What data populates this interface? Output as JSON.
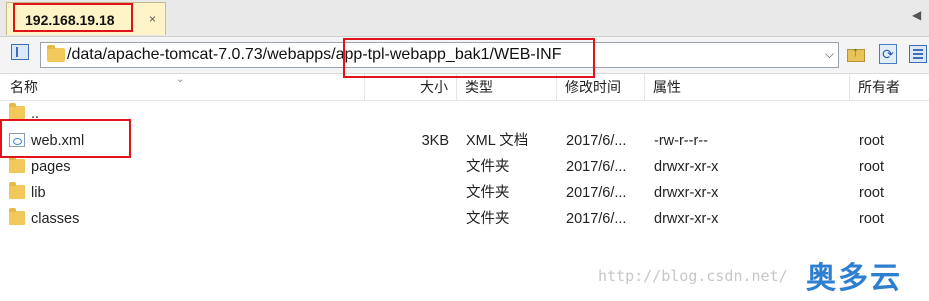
{
  "tab": {
    "title": "192.168.19.18",
    "close_glyph": "×"
  },
  "nav": {
    "scroll_glyph": "◀"
  },
  "address": {
    "path_part1": "/data/apache-tomcat-7.0.73/webapps/",
    "path_part2": "app-tpl-webapp_bak1/WEB-INF",
    "dropdown_glyph": "⌵"
  },
  "toolbar": {
    "up_icon": "parent-folder-icon",
    "refresh_icon": "refresh-icon",
    "view_icon": "view-mode-icon",
    "refresh_glyph": "⟳",
    "up_glyph": "↑"
  },
  "columns": {
    "name": "名称",
    "size": "大小",
    "type": "类型",
    "modified": "修改时间",
    "attributes": "属性",
    "owner": "所有者",
    "sort_glyph": "⌄"
  },
  "files": [
    {
      "name": "..",
      "icon": "folder-icon",
      "size": "",
      "type": "",
      "modified": "",
      "attributes": "",
      "owner": ""
    },
    {
      "name": "web.xml",
      "icon": "xml-file-icon",
      "size": "3KB",
      "type": "XML 文档",
      "modified": "2017/6/...",
      "attributes": "-rw-r--r--",
      "owner": "root"
    },
    {
      "name": "pages",
      "icon": "folder-icon",
      "size": "",
      "type": "文件夹",
      "modified": "2017/6/...",
      "attributes": "drwxr-xr-x",
      "owner": "root"
    },
    {
      "name": "lib",
      "icon": "folder-icon",
      "size": "",
      "type": "文件夹",
      "modified": "2017/6/...",
      "attributes": "drwxr-xr-x",
      "owner": "root"
    },
    {
      "name": "classes",
      "icon": "folder-icon",
      "size": "",
      "type": "文件夹",
      "modified": "2017/6/...",
      "attributes": "drwxr-xr-x",
      "owner": "root"
    }
  ],
  "watermark": {
    "url": "http://blog.csdn.net/",
    "logo": "奥多云"
  },
  "colors": {
    "highlight": "#e0131b",
    "tab_bg": "#fff3c8",
    "folder": "#f3c85b",
    "logo": "#2f7fd1"
  }
}
